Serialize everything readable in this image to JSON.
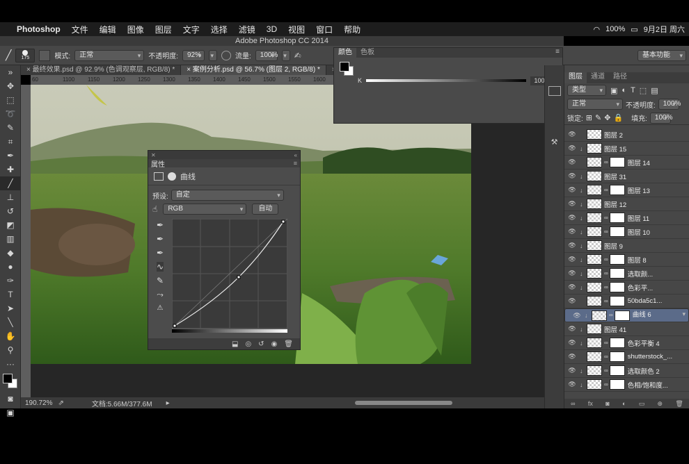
{
  "menubar": {
    "app": "Photoshop",
    "items": [
      "文件",
      "编辑",
      "图像",
      "图层",
      "文字",
      "选择",
      "滤镜",
      "3D",
      "视图",
      "窗口",
      "帮助"
    ],
    "battery": "100%",
    "date": "9月2日 周六"
  },
  "window_title": "Adobe Photoshop CC 2014",
  "options": {
    "brush_size": "175",
    "mode_label": "模式:",
    "mode_value": "正常",
    "opacity_label": "不透明度:",
    "opacity_value": "92%",
    "flow_label": "流量:",
    "flow_value": "100%",
    "workspace": "基本功能"
  },
  "tabs": [
    {
      "label": "最终效果.psd @ 92.9% (色调观察层, RGB/8) *"
    },
    {
      "label": "案例分析.psd @ 56.7% (图层 2, RGB/8) *"
    },
    {
      "label": "案"
    }
  ],
  "ruler_ticks": [
    "60",
    "1100",
    "1150",
    "1200",
    "1250",
    "1300",
    "1350",
    "1400",
    "1450",
    "1500",
    "1550",
    "1600"
  ],
  "color_panel": {
    "tabs": [
      "颜色",
      "色板"
    ],
    "channel": "K",
    "value": "100",
    "unit": "%"
  },
  "properties": {
    "title": "属性",
    "subtitle": "曲线",
    "preset_label": "预设:",
    "preset_value": "自定",
    "channel_value": "RGB",
    "auto_label": "自动"
  },
  "status": {
    "zoom": "190.72%",
    "doc": "文档:5.66M/377.6M"
  },
  "layers_panel": {
    "tabs": [
      "图层",
      "通道",
      "路径"
    ],
    "filter": "类型",
    "blend": "正常",
    "opacity_label": "不透明度:",
    "opacity_value": "100%",
    "lock_label": "锁定:",
    "fill_label": "填充:",
    "fill_value": "100%",
    "layers": [
      {
        "name": "图层 2",
        "clip": false,
        "mask": false,
        "sel": false
      },
      {
        "name": "图层 15",
        "clip": true,
        "mask": false,
        "sel": false
      },
      {
        "name": "图层 14",
        "clip": false,
        "mask": true,
        "sel": false
      },
      {
        "name": "图层 31",
        "clip": true,
        "mask": false,
        "sel": false
      },
      {
        "name": "图层 13",
        "clip": true,
        "mask": true,
        "sel": false
      },
      {
        "name": "图层 12",
        "clip": true,
        "mask": false,
        "sel": false
      },
      {
        "name": "图层 11",
        "clip": true,
        "mask": true,
        "sel": false
      },
      {
        "name": "图层 10",
        "clip": true,
        "mask": true,
        "sel": false
      },
      {
        "name": "图层 9",
        "clip": true,
        "mask": false,
        "sel": false
      },
      {
        "name": "图层 8",
        "clip": true,
        "mask": true,
        "sel": false
      },
      {
        "name": "选取颜...",
        "clip": true,
        "mask": true,
        "sel": false
      },
      {
        "name": "色彩平...",
        "clip": true,
        "mask": true,
        "sel": false
      },
      {
        "name": "50bda5c1...",
        "clip": false,
        "mask": true,
        "sel": false
      },
      {
        "name": "曲线 6",
        "clip": true,
        "mask": true,
        "sel": true
      },
      {
        "name": "图层 41",
        "clip": true,
        "mask": false,
        "sel": false
      },
      {
        "name": "色彩平衡 4",
        "clip": true,
        "mask": true,
        "sel": false
      },
      {
        "name": "shutterstock_...",
        "clip": false,
        "mask": true,
        "sel": false
      },
      {
        "name": "选取颜色 2",
        "clip": true,
        "mask": true,
        "sel": false
      },
      {
        "name": "色相/饱和度...",
        "clip": true,
        "mask": true,
        "sel": false
      }
    ]
  }
}
